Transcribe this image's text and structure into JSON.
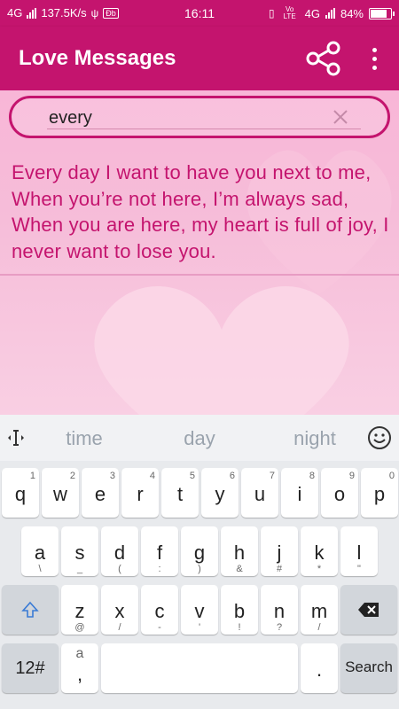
{
  "status_bar": {
    "network_type": "4G",
    "speed": "137.5K/s",
    "time": "16:11",
    "volte": "Vo LTE",
    "network_type_2": "4G",
    "battery_percent": "84%",
    "battery_level": 0.84
  },
  "app_bar": {
    "title": "Love Messages",
    "share_icon": "share-icon",
    "menu_icon": "more-vert-icon"
  },
  "search": {
    "value": "every",
    "clear_icon": "clear-icon"
  },
  "messages": [
    "Every day I want to have you next to me, When you’re not here, I’m always sad, When you are here, my heart is full of joy, I never want to lose you."
  ],
  "keyboard": {
    "suggestions": [
      "time",
      "day",
      "night"
    ],
    "row1": [
      {
        "main": "q",
        "sub": "1"
      },
      {
        "main": "w",
        "sub": "2"
      },
      {
        "main": "e",
        "sub": "3"
      },
      {
        "main": "r",
        "sub": "4"
      },
      {
        "main": "t",
        "sub": "5"
      },
      {
        "main": "y",
        "sub": "6"
      },
      {
        "main": "u",
        "sub": "7"
      },
      {
        "main": "i",
        "sub": "8"
      },
      {
        "main": "o",
        "sub": "9"
      },
      {
        "main": "p",
        "sub": "0"
      }
    ],
    "row2": [
      {
        "main": "a",
        "sub": "\\"
      },
      {
        "main": "s",
        "sub": "_"
      },
      {
        "main": "d",
        "sub": "("
      },
      {
        "main": "f",
        "sub": ":"
      },
      {
        "main": "g",
        "sub": ")"
      },
      {
        "main": "h",
        "sub": "&"
      },
      {
        "main": "j",
        "sub": "#"
      },
      {
        "main": "k",
        "sub": "*"
      },
      {
        "main": "l",
        "sub": "\""
      }
    ],
    "row3": [
      {
        "main": "z",
        "sub": "@"
      },
      {
        "main": "x",
        "sub": "/"
      },
      {
        "main": "c",
        "sub": "-"
      },
      {
        "main": "v",
        "sub": "'"
      },
      {
        "main": "b",
        "sub": "!"
      },
      {
        "main": "n",
        "sub": "?"
      },
      {
        "main": "m",
        "sub": "/"
      }
    ],
    "symbols_key": "12#",
    "comma_key": ",",
    "comma_sub": "a",
    "period_key": ".",
    "action_key": "Search"
  },
  "colors": {
    "primary": "#c4146e",
    "message_text": "#c4146e",
    "keyboard_bg": "#e8eaed"
  }
}
